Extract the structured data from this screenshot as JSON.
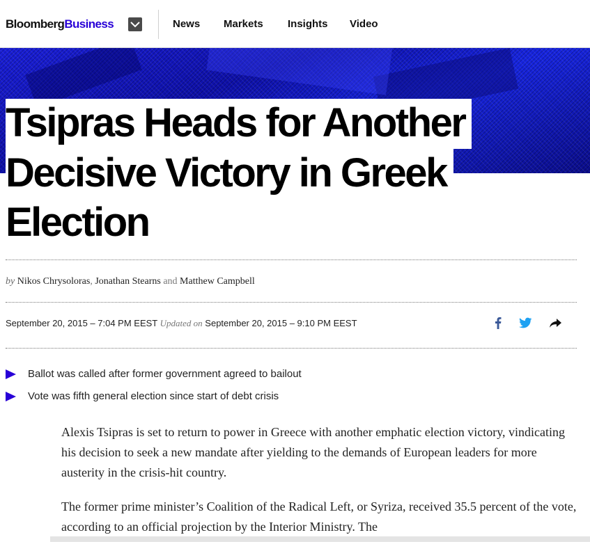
{
  "header": {
    "logo_part1": "Bloomberg",
    "logo_part2": "Business",
    "nav": [
      "News",
      "Markets",
      "Insights",
      "Video"
    ]
  },
  "article": {
    "headline_lines": [
      "Tsipras Heads for Another",
      "Decisive Victory in Greek",
      "Election"
    ],
    "byline": {
      "prefix": "by",
      "authors": [
        "Nikos Chrysoloras",
        "Jonathan Stearns",
        "Matthew Campbell"
      ],
      "and": "and"
    },
    "published": "September 20, 2015 – 7:04 PM EEST",
    "updated_label": "Updated on",
    "updated": "September 20, 2015 – 9:10 PM EEST",
    "bullets": [
      "Ballot was called after former government agreed to bailout",
      "Vote was fifth general election since start of debt crisis"
    ],
    "paragraphs": [
      "Alexis Tsipras is set to return to power in Greece with another emphatic election victory, vindicating his decision to seek a new mandate after yielding to the demands of European leaders for more austerity in the crisis-hit country.",
      "The former prime minister’s Coalition of the Radical Left, or Syriza, received 35.5 percent of the vote, according to an official projection by the Interior Ministry. The"
    ]
  },
  "colors": {
    "accent": "#2800d7",
    "facebook": "#3b5998",
    "twitter": "#1da1f2"
  },
  "icons": {
    "menu": "chevron-down-icon",
    "share": [
      "facebook-icon",
      "twitter-icon",
      "share-arrow-icon"
    ],
    "bullet": "triangle-bullet-icon"
  }
}
